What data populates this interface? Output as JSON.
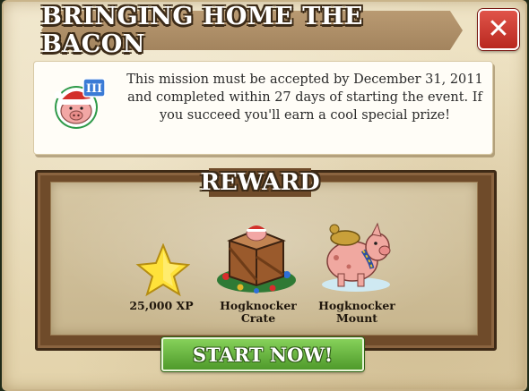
{
  "dialog": {
    "title": "BRINGING HOME THE BACON",
    "close_label": "✕",
    "mission_icon": "pig-santa-hat-icon",
    "mission_tier": "III",
    "description": "This mission must be accepted by December 31, 2011 and completed within 27 days of starting the event. If you succeed you'll earn a cool special prize!"
  },
  "reward": {
    "heading": "REWARD",
    "items": [
      {
        "icon": "star-icon",
        "label": "25,000 XP"
      },
      {
        "icon": "hogknocker-crate-icon",
        "label": "Hogknocker Crate"
      },
      {
        "icon": "hogknocker-mount-icon",
        "label": "Hogknocker Mount"
      }
    ]
  },
  "actions": {
    "start_label": "START NOW!"
  },
  "colors": {
    "parchment": "#e9dcbc",
    "close": "#d4423a",
    "start": "#6cbd43",
    "frame": "#6f4b2a"
  }
}
